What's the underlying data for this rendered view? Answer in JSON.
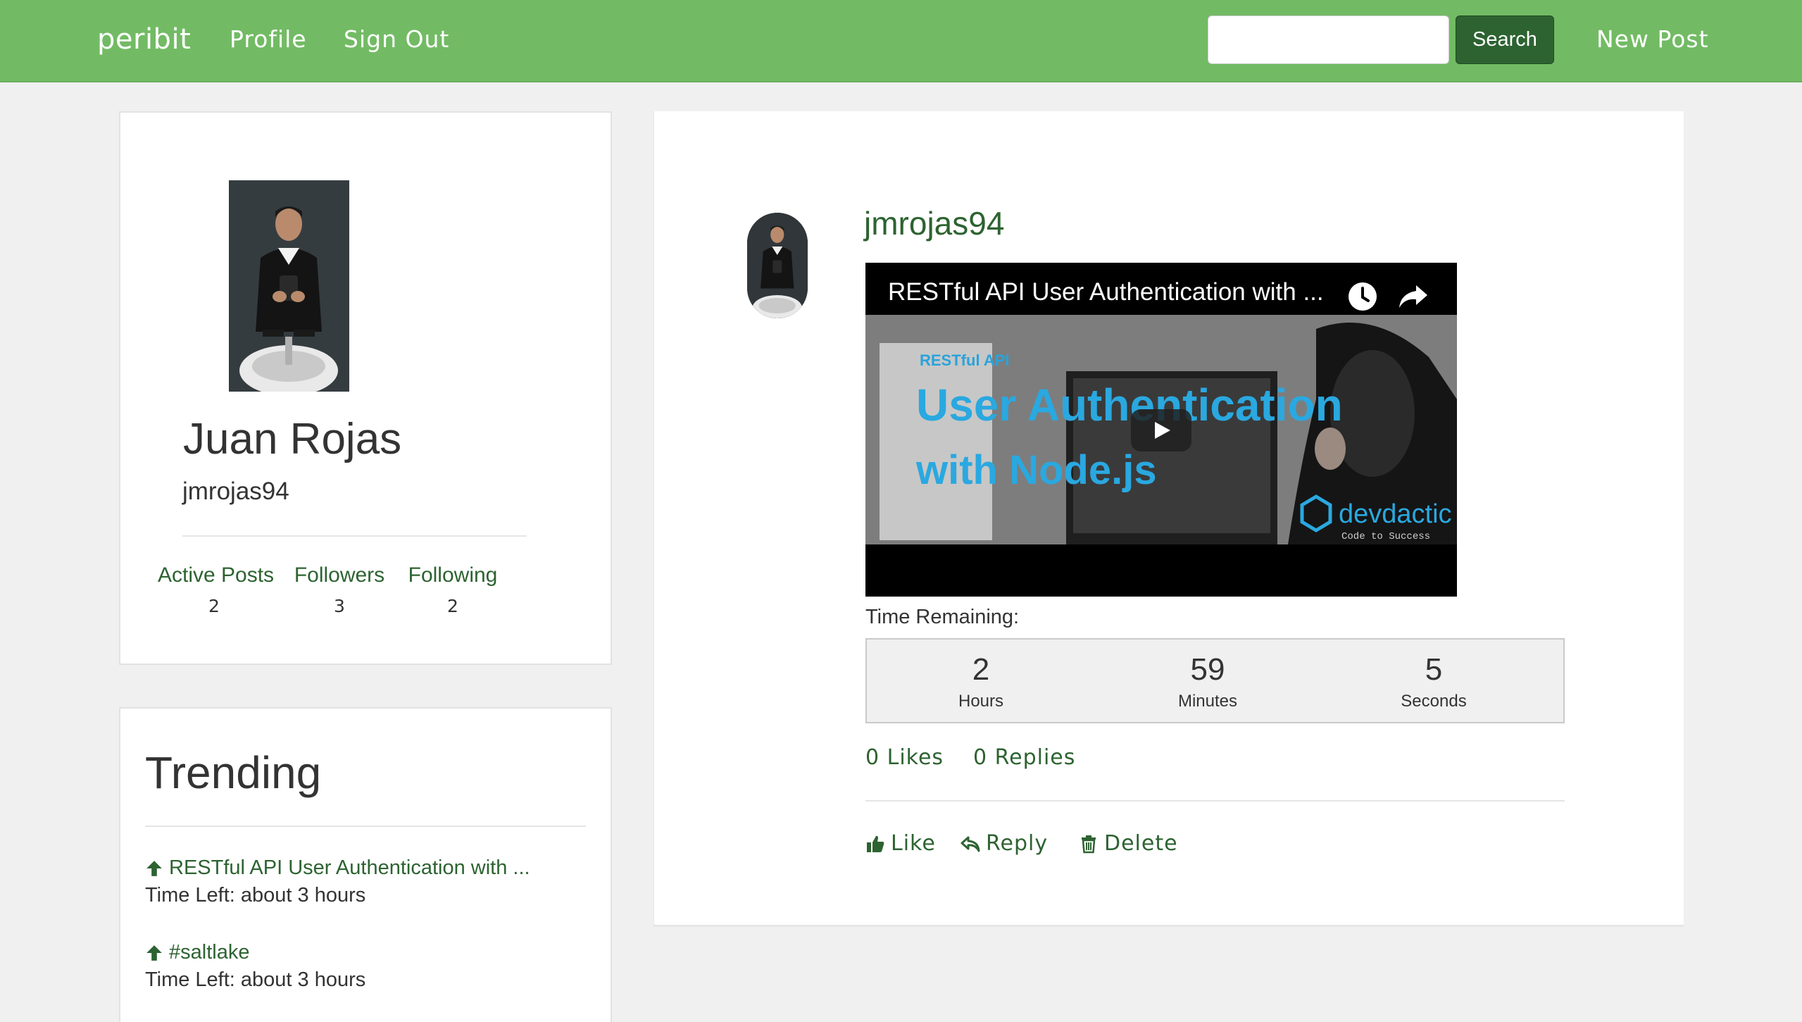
{
  "navbar": {
    "brand": "peribit",
    "profile": "Profile",
    "sign_out": "Sign Out",
    "search_placeholder": "",
    "search_button": "Search",
    "new_post": "New Post",
    "bg_color": "#72bb64",
    "button_color": "#2d6331"
  },
  "profile": {
    "name": "Juan Rojas",
    "handle": "jmrojas94",
    "stats": [
      {
        "label": "Active Posts",
        "value": "2"
      },
      {
        "label": "Followers",
        "value": "3"
      },
      {
        "label": "Following",
        "value": "2"
      }
    ]
  },
  "trending": {
    "title": "Trending",
    "items": [
      {
        "title": "RESTful API User Authentication with ...",
        "time_left": "Time Left: about 3 hours",
        "icon": "arrow-up-icon"
      },
      {
        "title": "#saltlake",
        "time_left": "Time Left: about 3 hours",
        "icon": "arrow-up-icon"
      }
    ]
  },
  "post": {
    "username": "jmrojas94",
    "video": {
      "title": "RESTful API User Authentication with ...",
      "thumb_small": "RESTful API",
      "thumb_line1": "User Authentication",
      "thumb_line2": "with Node.js",
      "thumb_brand": "devdactic",
      "thumb_tagline": "Code to Success"
    },
    "time_remaining_label": "Time Remaining:",
    "countdown": {
      "hours": "2",
      "hours_label": "Hours",
      "minutes": "59",
      "minutes_label": "Minutes",
      "seconds": "5",
      "seconds_label": "Seconds"
    },
    "likes_count": "0 Likes",
    "replies_count": "0 Replies",
    "actions": {
      "like": "Like",
      "reply": "Reply",
      "delete": "Delete"
    },
    "accent_color": "#2d6331"
  }
}
